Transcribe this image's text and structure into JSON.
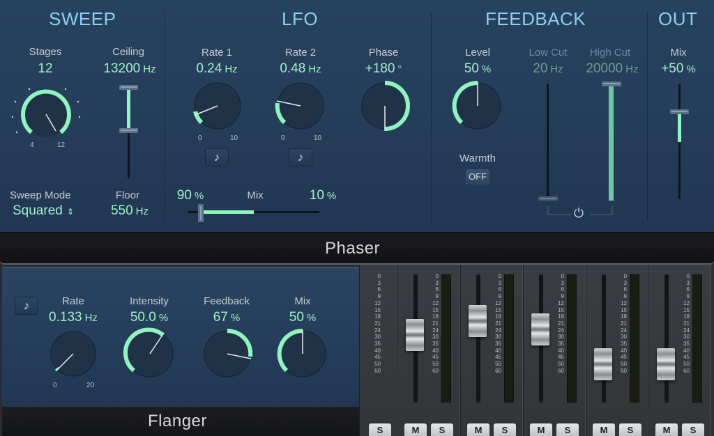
{
  "phaser": {
    "plugin_name": "Phaser",
    "sweep": {
      "title": "SWEEP",
      "stages_label": "Stages",
      "stages_value": "12",
      "stages_min": "4",
      "stages_max": "12",
      "ceiling_label": "Ceiling",
      "ceiling_value": "13200",
      "ceiling_unit": "Hz",
      "floor_label": "Floor",
      "floor_value": "550",
      "floor_unit": "Hz",
      "sweep_mode_label": "Sweep Mode",
      "sweep_mode_value": "Squared"
    },
    "lfo": {
      "title": "LFO",
      "rate1_label": "Rate 1",
      "rate1_value": "0.24",
      "rate1_unit": "Hz",
      "rate2_label": "Rate 2",
      "rate2_value": "0.48",
      "rate2_unit": "Hz",
      "range_min": "0",
      "range_max": "10",
      "phase_label": "Phase",
      "phase_value": "+180",
      "phase_unit": "°",
      "mix_label": "Mix",
      "mix_left_value": "90",
      "mix_right_value": "10",
      "mix_unit": "%"
    },
    "feedback": {
      "title": "FEEDBACK",
      "level_label": "Level",
      "level_value": "50",
      "level_unit": "%",
      "low_cut_label": "Low Cut",
      "low_cut_value": "20",
      "low_cut_unit": "Hz",
      "high_cut_label": "High Cut",
      "high_cut_value": "20000",
      "high_cut_unit": "Hz",
      "warmth_label": "Warmth",
      "warmth_value": "OFF"
    },
    "out": {
      "title": "OUT",
      "mix_label": "Mix",
      "mix_value": "+50",
      "mix_unit": "%"
    }
  },
  "flanger": {
    "plugin_name": "Flanger",
    "rate_label": "Rate",
    "rate_value": "0.133",
    "rate_unit": "Hz",
    "rate_min": "0",
    "rate_max": "20",
    "intensity_label": "Intensity",
    "intensity_value": "50.0",
    "intensity_unit": "%",
    "feedback_label": "Feedback",
    "feedback_value": "67",
    "feedback_unit": "%",
    "mix_label": "Mix",
    "mix_value": "50",
    "mix_unit": "%"
  },
  "mixer": {
    "scale": [
      "0",
      "3",
      "6",
      "9",
      "12",
      "15",
      "18",
      "21",
      "24",
      "30",
      "35",
      "40",
      "45",
      "50",
      "60"
    ],
    "mute_label": "M",
    "solo_label": "S"
  },
  "colors": {
    "accent": "#9ff2c5",
    "title": "#8bd1f0",
    "panel": "#243c58"
  },
  "icons": {
    "note": "♪",
    "power": "⏻",
    "chevron": "⌃⌄"
  }
}
